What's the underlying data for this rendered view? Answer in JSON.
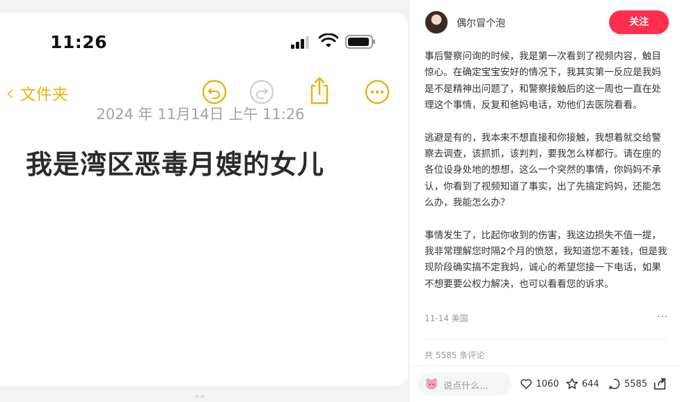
{
  "note": {
    "status_time": "11:26",
    "back_label": "文件夹",
    "date": "2024 年 11月14日 上午 11:26",
    "title": "我是湾区恶毒月嫂的女儿"
  },
  "post": {
    "username": "偶尔冒个泡",
    "follow_label": "关注",
    "paragraphs": [
      "事后警察问询的时候，我是第一次看到了视频内容，触目惊心。在确定宝宝安好的情况下，我其实第一反应是我妈是不是精神出问题了，和警察接触后的这一周也一直在处理这个事情，反复和爸妈电话，劝他们去医院看看。",
      "逃避是有的，我本来不想直接和你接触，我想着就交给警察去调查，该抓抓，该判判，要我怎么样都行。请在座的各位设身处地的想想，这么一个突然的事情，你妈妈不承认，你看到了视频知道了事实，出了先搞定妈妈，还能怎么办，我能怎么办？",
      "事情发生了，比起你收到的伤害，我这边损失不值一提，我非常理解您时隔2个月的愤怒，我知道您不差钱，但是我现阶段确实搞不定我妈，诚心的希望您接一下电话，如果不想要要公权力解决，也可以看看您的诉求。"
    ],
    "meta": "11-14 美国",
    "more": "···",
    "comment_count": "共 5585 条评论",
    "comment_placeholder": "说点什么...",
    "likes": "1060",
    "stars": "644",
    "comments": "5585",
    "accent_color": "#ff2e4d",
    "notes_accent": "#e6b30e"
  }
}
